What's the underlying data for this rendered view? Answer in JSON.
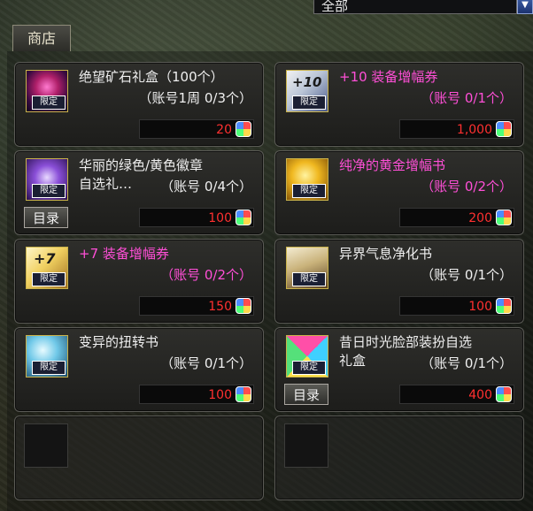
{
  "filter": {
    "selected": "全部"
  },
  "tab": {
    "label": "商店"
  },
  "badge_text": "限定",
  "catalog_label": "目录",
  "colors": {
    "pink": "#ff4fd7",
    "price_red": "#ff3030",
    "frame_gold": "#c9b24a"
  },
  "items": [
    {
      "name": "绝望矿石礼盒（100个）",
      "limit": "（账号1周 0/3个）",
      "price": "20",
      "pink": false,
      "icon": "despair-ore-box-icon"
    },
    {
      "name": "+10 装备增幅券",
      "limit": "（账号 0/1个）",
      "price": "1,000",
      "pink": true,
      "icon": "plus10-amplify-ticket-icon"
    },
    {
      "name": "华丽的绿色/黄色徽章\n自选礼…",
      "limit": "（账号 0/4个）",
      "price": "100",
      "pink": false,
      "icon": "emblem-box-icon",
      "catalog": true
    },
    {
      "name": "纯净的黄金增幅书",
      "limit": "（账号 0/2个）",
      "price": "200",
      "pink": true,
      "icon": "gold-amplify-book-icon"
    },
    {
      "name": "+7 装备增幅券",
      "limit": "（账号 0/2个）",
      "price": "150",
      "pink": true,
      "icon": "plus7-amplify-ticket-icon"
    },
    {
      "name": "异界气息净化书",
      "limit": "（账号 0/1个）",
      "price": "100",
      "pink": false,
      "icon": "purify-book-icon"
    },
    {
      "name": "变异的扭转书",
      "limit": "（账号 0/1个）",
      "price": "100",
      "pink": false,
      "icon": "twist-book-icon"
    },
    {
      "name": "昔日时光脸部装扮自选\n礼盒",
      "limit": "（账号 0/1个）",
      "price": "400",
      "pink": false,
      "icon": "face-avatar-box-icon",
      "catalog": true
    }
  ]
}
